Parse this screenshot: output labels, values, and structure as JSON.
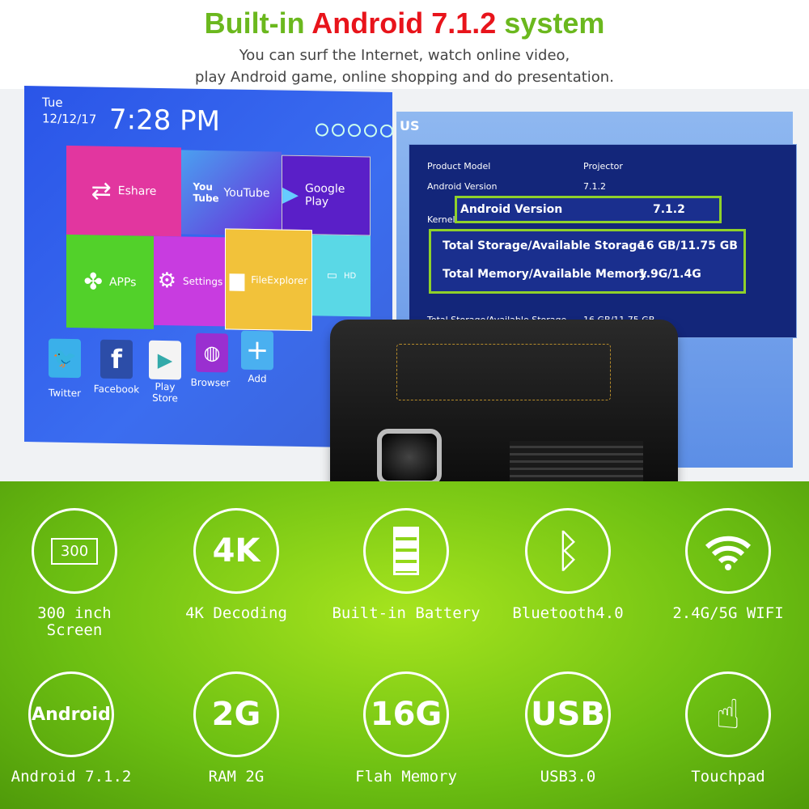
{
  "header": {
    "title_a": "Built-in ",
    "title_b": "Android 7.1.2",
    "title_c": " system",
    "subtitle_1": "You can surf the Internet, watch online video,",
    "subtitle_2": "play Android game, online shopping and do presentation."
  },
  "home_screen": {
    "day": "Tue",
    "date": "12/12/17",
    "time": "7:28 PM",
    "tiles": [
      "Eshare",
      "YouTube",
      "Google Play",
      "APPs",
      "Settings",
      "FileExplorer",
      "HD"
    ],
    "youtube_logo": "You Tube",
    "apps": [
      {
        "label": "Twitter",
        "icon": "twitter-icon"
      },
      {
        "label": "Facebook",
        "icon": "facebook-icon"
      },
      {
        "label": "Play Store",
        "icon": "play-store-icon"
      },
      {
        "label": "Browser",
        "icon": "globe-icon"
      },
      {
        "label": "Add",
        "icon": "plus-icon"
      }
    ]
  },
  "about_screen": {
    "title": "US",
    "rows": [
      [
        "Product Model",
        "Projector"
      ],
      [
        "Android Version",
        "7.1.2"
      ],
      [
        "Kernel",
        ""
      ],
      [
        "Total Storage/Available Storage",
        "16 GB/11.75 GB"
      ]
    ],
    "callout_1": [
      "Android Version",
      "7.1.2"
    ],
    "callout_2": [
      [
        "Total Storage/Available Storage",
        "16 GB/11.75 GB"
      ],
      [
        "Total Memory/Available Memory",
        "1.9G/1.4G"
      ]
    ]
  },
  "features": [
    {
      "icon_text": "300",
      "label": "300 inch Screen",
      "icon": "screen-icon"
    },
    {
      "icon_text": "4K",
      "label": "4K Decoding",
      "icon": "4k-icon"
    },
    {
      "icon_text": "",
      "label": "Built-in Battery",
      "icon": "battery-icon"
    },
    {
      "icon_text": "",
      "label": "Bluetooth4.0",
      "icon": "bluetooth-icon"
    },
    {
      "icon_text": "",
      "label": "2.4G/5G WIFI",
      "icon": "wifi-icon"
    },
    {
      "icon_text": "Android",
      "label": "Android 7.1.2",
      "icon": "android-icon"
    },
    {
      "icon_text": "2G",
      "label": "RAM 2G",
      "icon": "ram-icon"
    },
    {
      "icon_text": "16G",
      "label": "Flah Memory",
      "icon": "memory-icon"
    },
    {
      "icon_text": "USB",
      "label": "USB3.0",
      "icon": "usb-icon"
    },
    {
      "icon_text": "",
      "label": "Touchpad",
      "icon": "touch-hand-icon"
    }
  ]
}
